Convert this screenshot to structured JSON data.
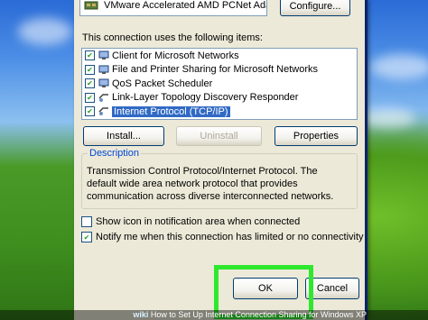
{
  "dialog": {
    "adapter_name": "VMware Accelerated AMD PCNet Ada",
    "configure_label": "Configure...",
    "items_heading": "This connection uses the following items:",
    "items": [
      {
        "label": "Client for Microsoft Networks",
        "checked": true,
        "selected": false,
        "icon": "network-client-icon"
      },
      {
        "label": "File and Printer Sharing for Microsoft Networks",
        "checked": true,
        "selected": false,
        "icon": "file-printer-sharing-icon"
      },
      {
        "label": "QoS Packet Scheduler",
        "checked": true,
        "selected": false,
        "icon": "qos-scheduler-icon"
      },
      {
        "label": "Link-Layer Topology Discovery Responder",
        "checked": true,
        "selected": false,
        "icon": "topology-responder-icon"
      },
      {
        "label": "Internet Protocol (TCP/IP)",
        "checked": true,
        "selected": true,
        "icon": "protocol-icon"
      }
    ],
    "install_label": "Install...",
    "uninstall_label": "Uninstall",
    "properties_label": "Properties",
    "description_heading": "Description",
    "description_text": "Transmission Control Protocol/Internet Protocol. The default wide area network protocol that provides communication across diverse interconnected networks.",
    "show_icon_label": "Show icon in notification area when connected",
    "show_icon_checked": false,
    "notify_label": "Notify me when this connection has limited or no connectivity",
    "notify_checked": true,
    "ok_label": "OK",
    "cancel_label": "Cancel"
  },
  "footer": {
    "brand": "wiki",
    "caption": "How to Set Up Internet Connection Sharing for Windows XP"
  },
  "colors": {
    "dialog_bg": "#ece9d8",
    "selection": "#316ac5",
    "highlight_box": "#2ee82e",
    "group_legend": "#0046d5"
  }
}
